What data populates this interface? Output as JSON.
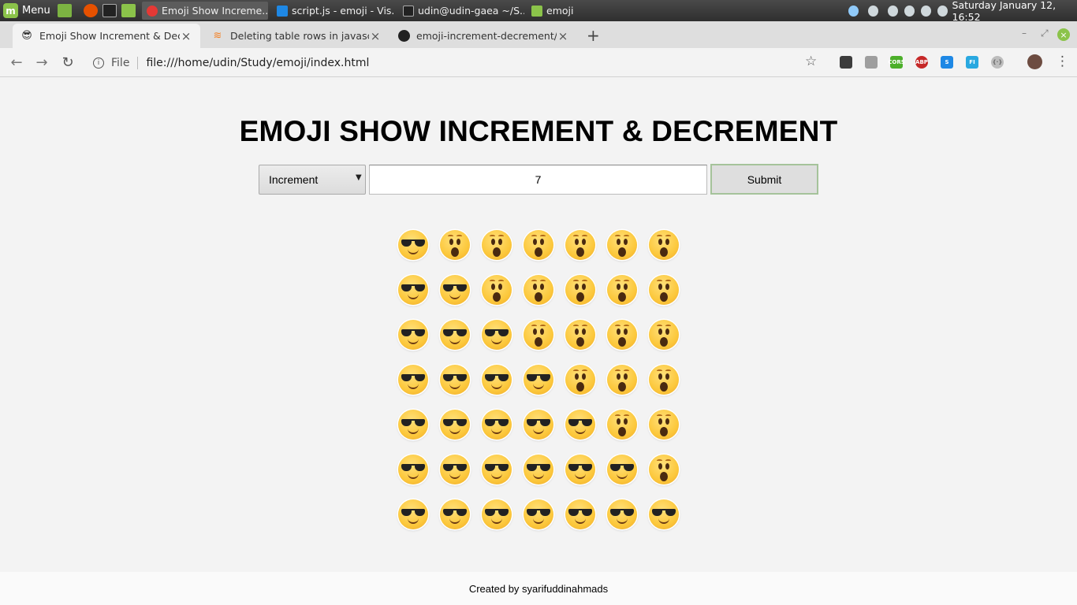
{
  "taskbar": {
    "menu_label": "Menu",
    "tasks": [
      {
        "label": "Emoji Show Increme...",
        "active": true
      },
      {
        "label": "script.js - emoji - Vis...",
        "active": false
      },
      {
        "label": "udin@udin-gaea ~/S...",
        "active": false
      },
      {
        "label": "emoji",
        "active": false
      }
    ],
    "clock": "Saturday January 12, 16:52"
  },
  "browser": {
    "tabs": [
      {
        "title": "Emoji Show Increment & Decre",
        "favicon": "😎",
        "active": true
      },
      {
        "title": "Deleting table rows in javascrip",
        "favicon": "stackoverflow-icon",
        "active": false
      },
      {
        "title": "emoji-increment-decrement/pr",
        "favicon": "github-icon",
        "active": false
      }
    ],
    "new_tab": "+",
    "scheme_label": "File",
    "url": "file:///home/udin/Study/emoji/index.html",
    "extensions": [
      {
        "name": "palette-extension-icon",
        "text": "",
        "color": "#3c3c3c"
      },
      {
        "name": "layers-extension-icon",
        "text": "",
        "color": "#9e9e9e"
      },
      {
        "name": "cors-extension-icon",
        "text": "CORS",
        "color": "#4caf2a"
      },
      {
        "name": "adblock-extension-icon",
        "text": "ABP",
        "color": "#c62828"
      },
      {
        "name": "s-extension-icon",
        "text": "S",
        "color": "#1e88e5"
      },
      {
        "name": "fi-extension-icon",
        "text": "FI",
        "color": "#29a8e0"
      },
      {
        "name": "json-extension-icon",
        "text": "{·}",
        "color": "#bdbdbd"
      }
    ]
  },
  "page": {
    "title": "EMOJI SHOW INCREMENT & DECREMENT",
    "select": {
      "selected": "Increment",
      "options": [
        "Increment"
      ]
    },
    "input_value": "7",
    "submit_label": "Submit",
    "grid": {
      "size": 7,
      "cool_emoji": "😎",
      "shocked_emoji": "😮",
      "rows": [
        [
          "cool",
          "shocked",
          "shocked",
          "shocked",
          "shocked",
          "shocked",
          "shocked"
        ],
        [
          "cool",
          "cool",
          "shocked",
          "shocked",
          "shocked",
          "shocked",
          "shocked"
        ],
        [
          "cool",
          "cool",
          "cool",
          "shocked",
          "shocked",
          "shocked",
          "shocked"
        ],
        [
          "cool",
          "cool",
          "cool",
          "cool",
          "shocked",
          "shocked",
          "shocked"
        ],
        [
          "cool",
          "cool",
          "cool",
          "cool",
          "cool",
          "shocked",
          "shocked"
        ],
        [
          "cool",
          "cool",
          "cool",
          "cool",
          "cool",
          "cool",
          "shocked"
        ],
        [
          "cool",
          "cool",
          "cool",
          "cool",
          "cool",
          "cool",
          "cool"
        ]
      ]
    },
    "footer": "Created by syarifuddinahmads"
  }
}
